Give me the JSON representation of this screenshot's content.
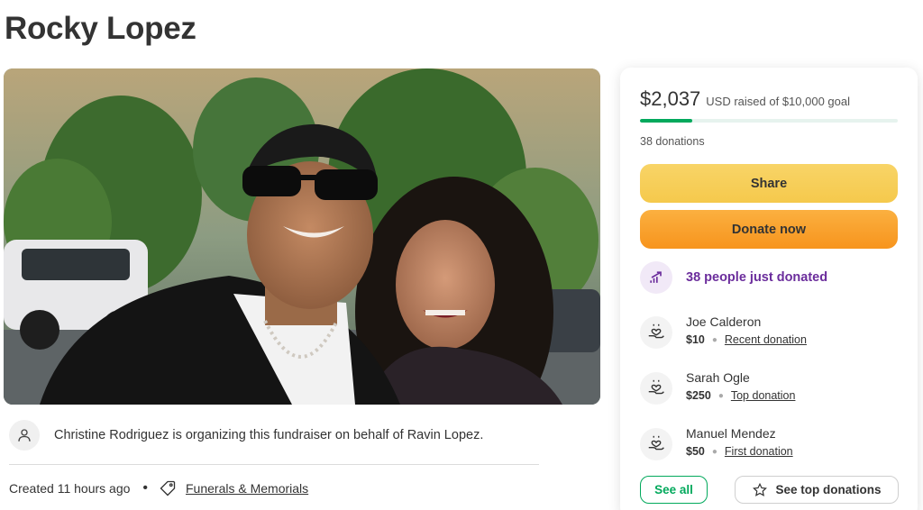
{
  "campaign": {
    "title": "Rocky Lopez",
    "organizer_text": "Christine Rodriguez is organizing this fundraiser on behalf of Ravin Lopez.",
    "created": "Created 11 hours ago",
    "separator": "•",
    "category": "Funerals & Memorials",
    "photo_description_icon": "campaign-photo"
  },
  "donation_card": {
    "amount": "$2,037",
    "goal_text": "USD raised of $10,000 goal",
    "progress_fraction": 0.2037,
    "donation_count": "38 donations",
    "share_label": "Share",
    "donate_label": "Donate now",
    "trend_text": "38 people just donated",
    "donors": [
      {
        "name": "Joe Calderon",
        "amount": "$10",
        "type": "Recent donation"
      },
      {
        "name": "Sarah Ogle",
        "amount": "$250",
        "type": "Top donation"
      },
      {
        "name": "Manuel Mendez",
        "amount": "$50",
        "type": "First donation"
      }
    ],
    "see_all_label": "See all",
    "see_top_label": "See top donations"
  },
  "colors": {
    "brand_green": "#02a95c",
    "share_yellow": "#f6cd56",
    "donate_orange": "#f8a030",
    "trend_purple": "#6b2d9c"
  },
  "icons": {
    "avatar": "person-icon",
    "category": "tag-icon",
    "trend": "trending-up-icon",
    "donor": "heart-hand-icon",
    "top": "star-icon"
  }
}
